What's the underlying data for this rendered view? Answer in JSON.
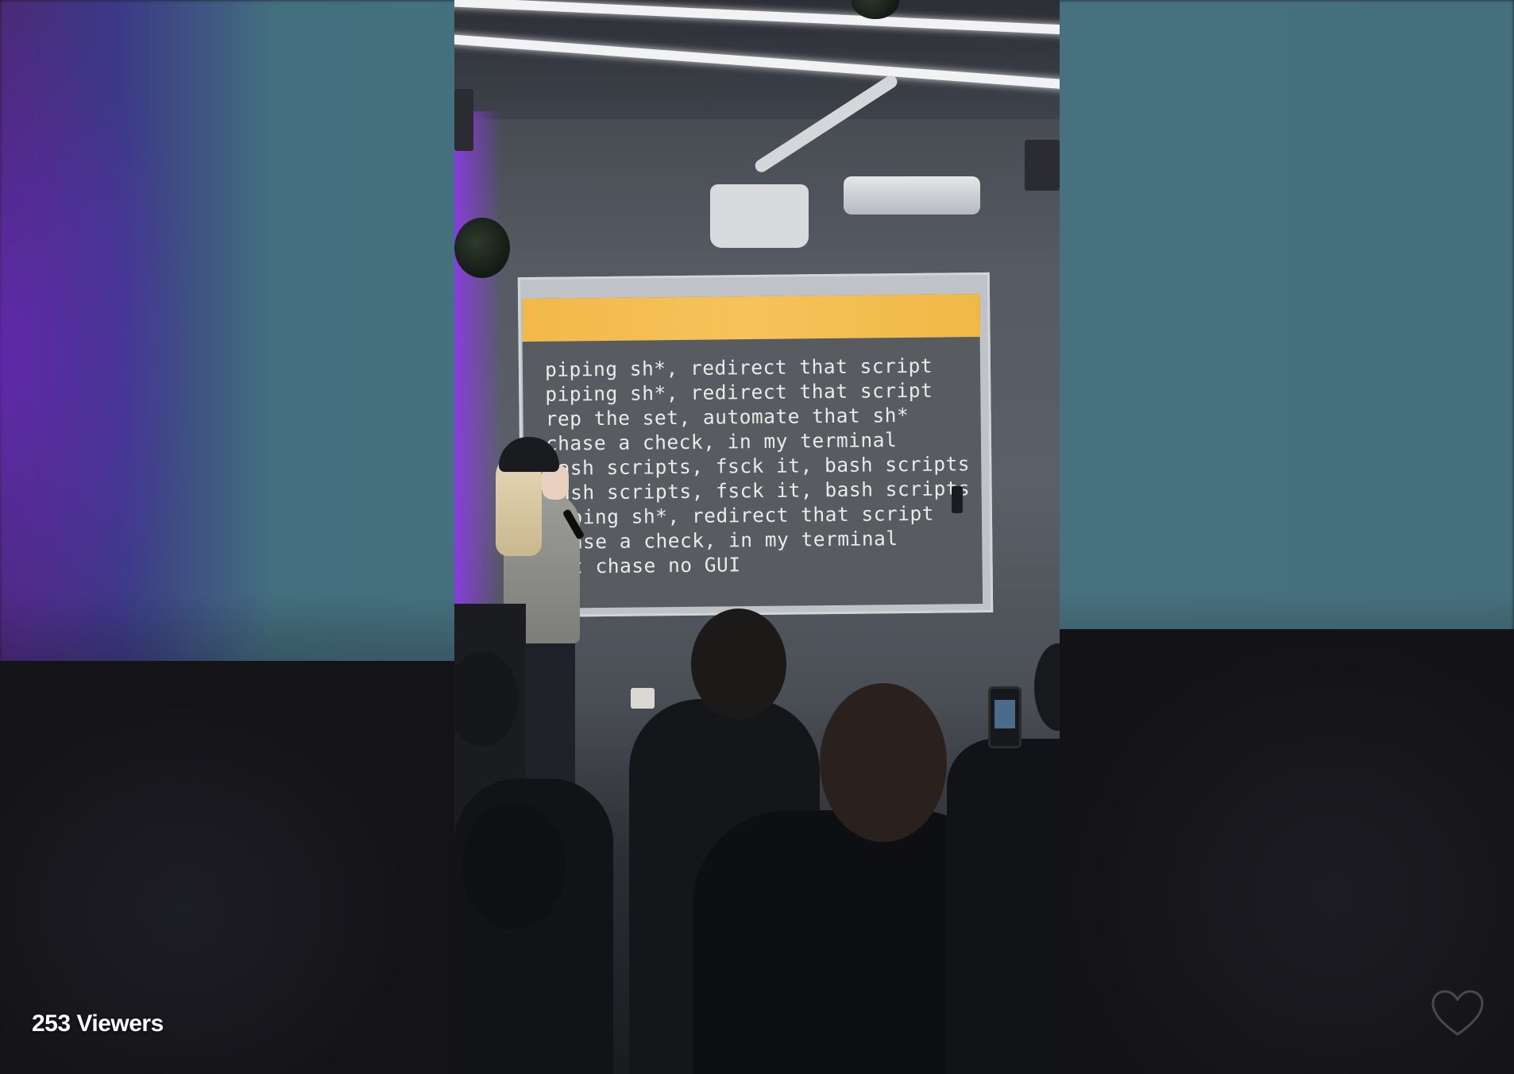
{
  "stream": {
    "viewer_count": "253 Viewers",
    "like_icon": "heart-outline-icon"
  },
  "slide": {
    "header_color": "#f4be55",
    "lines": [
      "piping sh*, redirect that script",
      "piping sh*, redirect that script",
      "rep the set, automate that sh*",
      "chase a check, in my terminal",
      "bash scripts, fsck it, bash scripts",
      "bash scripts, fsck it, bash scripts",
      "piping sh*, redirect that script",
      "chase a check, in my terminal",
      "but chase no GUI"
    ]
  },
  "colors": {
    "background_teal": "#48727f",
    "stage_purple": "#8c3ce6",
    "overlay_text": "#ffffff"
  }
}
